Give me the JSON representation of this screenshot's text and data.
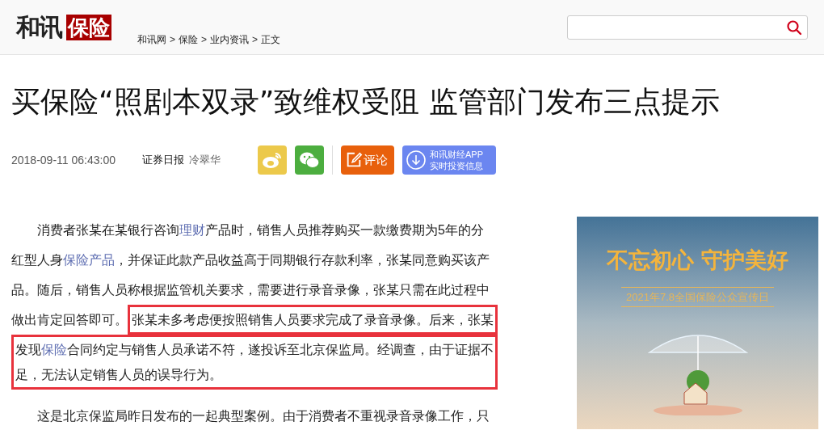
{
  "header": {
    "logo_text": "和讯",
    "logo_badge": "保险",
    "breadcrumb": [
      {
        "label": "和讯网"
      },
      {
        "label": "保险"
      },
      {
        "label": "业内资讯"
      },
      {
        "label": "正文"
      }
    ],
    "separator": ">"
  },
  "article": {
    "title": "买保险“照剧本双录”致维权受阻 监管部门发布三点提示",
    "date": "2018-09-11 06:43:00",
    "source": "证券日报",
    "author": "冷翠华",
    "share_buttons": [
      {
        "kind": "weibo"
      },
      {
        "kind": "wechat"
      }
    ],
    "comment_button": "评论",
    "app_button": {
      "line1": "和讯财经APP",
      "line2": "实时投资信息"
    },
    "paragraphs": [
      {
        "rows": [
          {
            "pieces": [
              {
                "highlighted": false,
                "lines": [
                  [
                    {
                      "text": "消费者张某在某银行咨询",
                      "link": false
                    },
                    {
                      "text": "理财",
                      "link": true
                    },
                    {
                      "text": "产品时，销售人员推荐购买一款缴费期为5年的分",
                      "link": false
                    }
                  ],
                  [
                    {
                      "text": "红型人身",
                      "link": false
                    },
                    {
                      "text": "保险产品",
                      "link": true
                    },
                    {
                      "text": "，并保证此款产品收益高于同期银行存款利率，张某同意购买该产",
                      "link": false
                    }
                  ],
                  [
                    {
                      "text": "品。随后，销售人员称根据监管机关要求，需要进行录音录像，张某只需在此过程中",
                      "link": false
                    }
                  ]
                ]
              }
            ]
          },
          {
            "pieces": [
              {
                "highlighted": false,
                "lines": [
                  [
                    {
                      "text": "做出肯定回答即可。",
                      "link": false
                    }
                  ]
                ]
              },
              {
                "highlighted": true,
                "lines": [
                  [
                    {
                      "text": "张某未多考虑便按照销售人员要求完成了录音录像。后来，张某",
                      "link": false
                    }
                  ]
                ]
              }
            ]
          },
          {
            "pieces": [
              {
                "highlighted": true,
                "lines": [
                  [
                    {
                      "text": "发现",
                      "link": false
                    },
                    {
                      "text": "保险",
                      "link": true
                    },
                    {
                      "text": "合同约定与销售人员承诺不符，遂投诉至北京保监局。经调查，由于证据不",
                      "link": false
                    }
                  ],
                  [
                    {
                      "text": "足，无法认定销售人员的误导行为。",
                      "link": false
                    }
                  ]
                ]
              }
            ]
          }
        ]
      },
      {
        "rows": [
          {
            "pieces": [
              {
                "highlighted": false,
                "lines": [
                  [
                    {
                      "text": "这是北京保监局昨日发布的一起典型案例。由于消费者不重视录音录像工作，只",
                      "link": false
                    }
                  ]
                ]
              }
            ]
          }
        ]
      }
    ]
  },
  "banner": {
    "headline": "不忘初心 守护美好",
    "subtitle": "2021年7.8全国保险公众宣传日"
  }
}
